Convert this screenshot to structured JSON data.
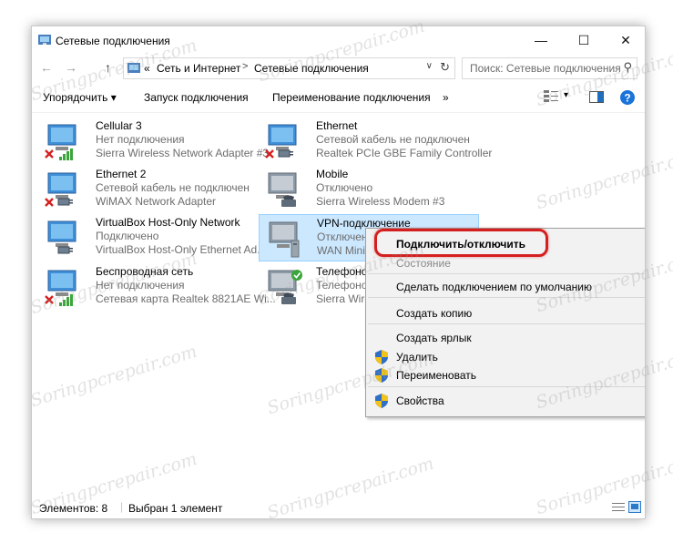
{
  "window": {
    "title": "Сетевые подключения",
    "minimize": "—",
    "maximize": "☐",
    "close": "✕"
  },
  "address": {
    "back": "←",
    "forward": "→",
    "up": "↑",
    "overflow": "«",
    "crumbs": [
      "Сеть и Интернет",
      "Сетевые подключения"
    ],
    "separator": ">",
    "dropdown": "∨",
    "refresh": "↻"
  },
  "search": {
    "placeholder": "Поиск: Сетевые подключения",
    "icon": "⚲"
  },
  "toolbar": {
    "organize": "Упорядочить ▾",
    "start_connection": "Запуск подключения",
    "rename_connection": "Переименование подключения",
    "more": "»",
    "view_dd": "▾"
  },
  "connections": [
    {
      "name": "Cellular 3",
      "status": "Нет подключения",
      "device": "Sierra Wireless Network Adapter #3",
      "icon": "cellular-disconnected"
    },
    {
      "name": "Ethernet",
      "status": "Сетевой кабель не подключен",
      "device": "Realtek PCIe GBE Family Controller",
      "icon": "ethernet-disconnected"
    },
    {
      "name": "Ethernet 2",
      "status": "Сетевой кабель не подключен",
      "device": "WiMAX Network Adapter",
      "icon": "ethernet-disconnected"
    },
    {
      "name": "Mobile",
      "status": "Отключено",
      "device": "Sierra Wireless Modem #3",
      "icon": "modem-disabled"
    },
    {
      "name": "VirtualBox Host-Only Network",
      "status": "Подключено",
      "device": "VirtualBox Host-Only Ethernet Ad...",
      "icon": "ethernet-connected"
    },
    {
      "name": "VPN-подключение",
      "status": "Отключено",
      "device": "WAN Minipo",
      "icon": "vpn-disabled"
    },
    {
      "name": "Беспроводная сеть",
      "status": "Нет подключения",
      "device": "Сетевая карта Realtek 8821AE Wi...",
      "icon": "wifi-disconnected"
    },
    {
      "name": "Телефоно",
      "status": "Телефоно",
      "device": "Sierra Wirele",
      "icon": "modem-connected"
    }
  ],
  "context_menu": {
    "connect": "Подключить/отключить",
    "status": "Состояние",
    "set_default": "Сделать подключением по умолчанию",
    "copy": "Создать копию",
    "shortcut": "Создать ярлык",
    "delete": "Удалить",
    "rename": "Переименовать",
    "properties": "Свойства"
  },
  "statusbar": {
    "items": "Элементов: 8",
    "selected": "Выбран 1 элемент"
  },
  "watermark": "Soringpcrepair.com",
  "colors": {
    "highlight": "#d51f1f",
    "selection": "#cce8ff",
    "help": "#1a73d9"
  }
}
